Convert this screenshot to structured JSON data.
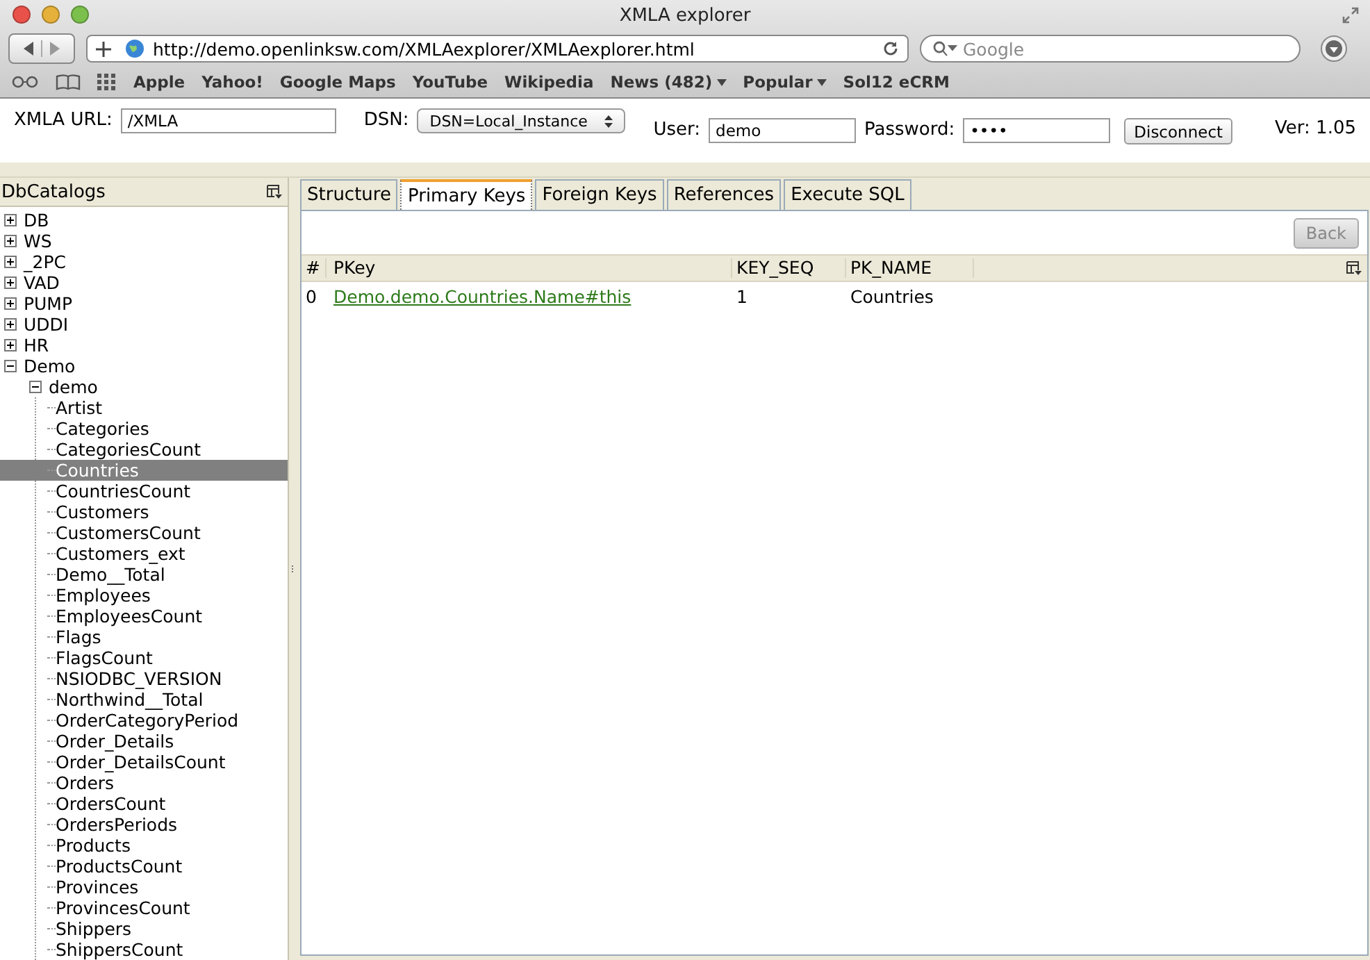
{
  "window": {
    "title": "XMLA explorer"
  },
  "address_bar": {
    "url": "http://demo.openlinksw.com/XMLAexplorer/XMLAexplorer.html"
  },
  "search": {
    "placeholder": "Google"
  },
  "bookmarks": [
    {
      "label": "Apple",
      "menu": false
    },
    {
      "label": "Yahoo!",
      "menu": false
    },
    {
      "label": "Google Maps",
      "menu": false
    },
    {
      "label": "YouTube",
      "menu": false
    },
    {
      "label": "Wikipedia",
      "menu": false
    },
    {
      "label": "News (482)",
      "menu": true
    },
    {
      "label": "Popular",
      "menu": true
    },
    {
      "label": "Sol12 eCRM",
      "menu": false
    }
  ],
  "connection": {
    "url_label": "XMLA URL:",
    "url_value": "/XMLA",
    "dsn_label": "DSN:",
    "dsn_value": "DSN=Local_Instance",
    "user_label": "User:",
    "user_value": "demo",
    "password_label": "Password:",
    "password_value": "••••",
    "disconnect": "Disconnect",
    "version": "Ver: 1.05"
  },
  "sidebar": {
    "title": "DbCatalogs",
    "items": [
      {
        "label": "DB",
        "expanded": false
      },
      {
        "label": "WS",
        "expanded": false
      },
      {
        "label": "_2PC",
        "expanded": false
      },
      {
        "label": "VAD",
        "expanded": false
      },
      {
        "label": "PUMP",
        "expanded": false
      },
      {
        "label": "UDDI",
        "expanded": false
      },
      {
        "label": "HR",
        "expanded": false
      },
      {
        "label": "Demo",
        "expanded": true,
        "children": [
          {
            "label": "demo",
            "expanded": true,
            "children": [
              {
                "label": "Artist",
                "selected": false
              },
              {
                "label": "Categories",
                "selected": false
              },
              {
                "label": "CategoriesCount",
                "selected": false
              },
              {
                "label": "Countries",
                "selected": true
              },
              {
                "label": "CountriesCount",
                "selected": false
              },
              {
                "label": "Customers",
                "selected": false
              },
              {
                "label": "CustomersCount",
                "selected": false
              },
              {
                "label": "Customers_ext",
                "selected": false
              },
              {
                "label": "Demo__Total",
                "selected": false
              },
              {
                "label": "Employees",
                "selected": false
              },
              {
                "label": "EmployeesCount",
                "selected": false
              },
              {
                "label": "Flags",
                "selected": false
              },
              {
                "label": "FlagsCount",
                "selected": false
              },
              {
                "label": "NSIODBC_VERSION",
                "selected": false
              },
              {
                "label": "Northwind__Total",
                "selected": false
              },
              {
                "label": "OrderCategoryPeriod",
                "selected": false
              },
              {
                "label": "Order_Details",
                "selected": false
              },
              {
                "label": "Order_DetailsCount",
                "selected": false
              },
              {
                "label": "Orders",
                "selected": false
              },
              {
                "label": "OrdersCount",
                "selected": false
              },
              {
                "label": "OrdersPeriods",
                "selected": false
              },
              {
                "label": "Products",
                "selected": false
              },
              {
                "label": "ProductsCount",
                "selected": false
              },
              {
                "label": "Provinces",
                "selected": false
              },
              {
                "label": "ProvincesCount",
                "selected": false
              },
              {
                "label": "Shippers",
                "selected": false
              },
              {
                "label": "ShippersCount",
                "selected": false
              }
            ]
          }
        ]
      }
    ]
  },
  "tabs": [
    {
      "label": "Structure",
      "selected": false
    },
    {
      "label": "Primary Keys",
      "selected": true
    },
    {
      "label": "Foreign Keys",
      "selected": false
    },
    {
      "label": "References",
      "selected": false
    },
    {
      "label": "Execute SQL",
      "selected": false
    }
  ],
  "back_button": {
    "label": "Back",
    "disabled": true
  },
  "table": {
    "columns": [
      "#",
      "PKey",
      "KEY_SEQ",
      "PK_NAME"
    ],
    "rows": [
      {
        "index": "0",
        "pkey": "Demo.demo.Countries.Name#this",
        "key_seq": "1",
        "pk_name": "Countries"
      }
    ]
  }
}
